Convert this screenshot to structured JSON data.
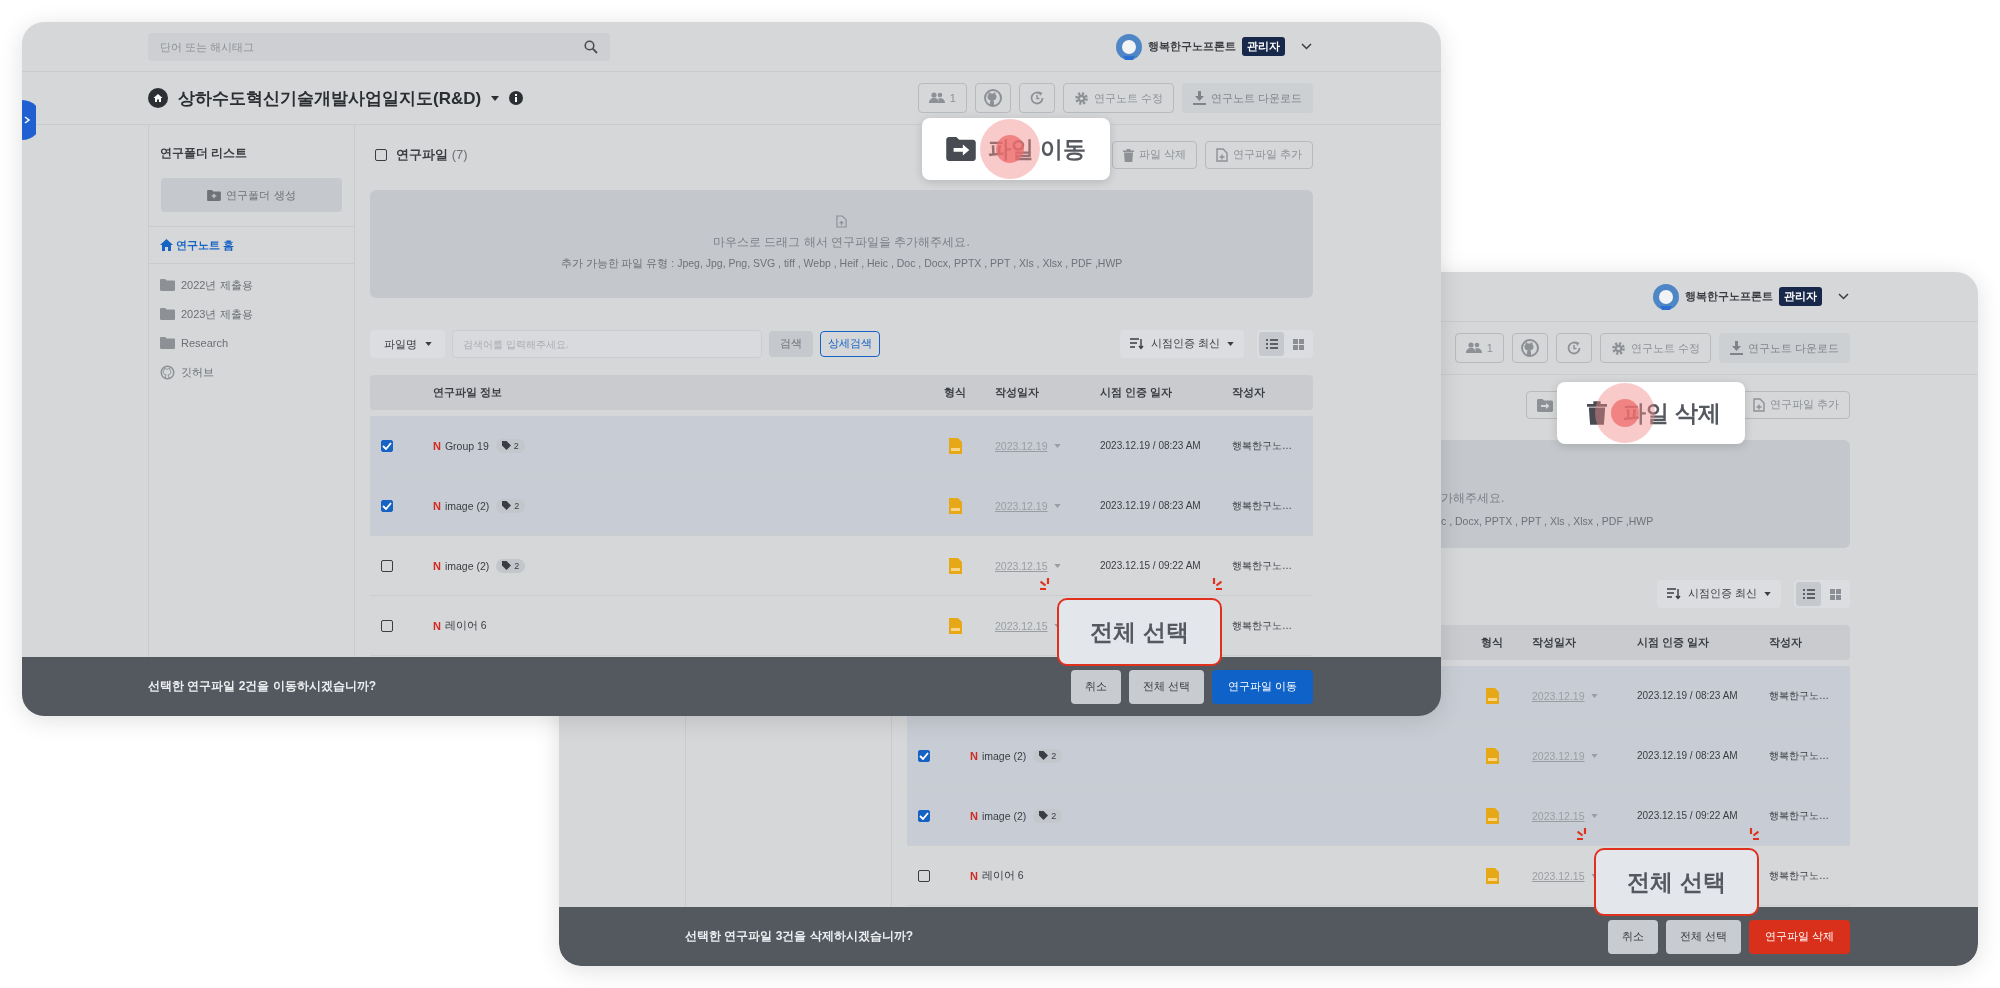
{
  "windows": [
    {
      "sidebar_toggle": true,
      "topbar": {
        "search": {
          "placeholder": "단어 또는 해시태그"
        },
        "user": {
          "name": "행복한구노프론트",
          "badge": "관리자"
        }
      },
      "header": {
        "title": "상하수도혁신기술개발사업일지도(R&D)",
        "toolbar": [
          {
            "kind": "members",
            "label": "1",
            "disabled": false
          },
          {
            "kind": "github",
            "disabled": false
          },
          {
            "kind": "history",
            "disabled": false
          },
          {
            "kind": "settings",
            "label": "연구노트 수정",
            "disabled": false
          },
          {
            "kind": "download",
            "label": "연구노트 다운로드",
            "disabled": true
          }
        ]
      },
      "folders": {
        "title": "연구폴더 리스트",
        "create_button": "연구폴더 생성",
        "home": "연구노트 홈",
        "items": [
          {
            "kind": "folder",
            "label": "2022년 제출용"
          },
          {
            "kind": "folder",
            "label": "2023년 제출용"
          },
          {
            "kind": "folder",
            "label": "Research"
          },
          {
            "kind": "github",
            "label": "깃허브"
          }
        ]
      },
      "files": {
        "title": "연구파일",
        "count": "(7)",
        "checked": false,
        "actions": [
          {
            "kind": "delete",
            "label": "파일 삭제"
          },
          {
            "kind": "add",
            "label": "연구파일 추가"
          }
        ],
        "dropzone": {
          "kind": "full",
          "message": "마우스로 드래그 해서 연구파일을 추가해주세요.",
          "types": "추가 가능한 파일 유형 : Jpeg, Jpg, Png, SVG , tiff , Webp , Heif , Heic , Doc , Docx, PPTX , PPT , Xls , Xlsx , PDF ,HWP"
        },
        "filter": {
          "field": "파일명",
          "placeholder": "검색어를 입력해주세요.",
          "search_button": "검색",
          "advanced_button": "상세검색",
          "sort": "시점인증 최신",
          "views": [
            {
              "kind": "list",
              "selected": true
            },
            {
              "kind": "grid",
              "selected": false
            }
          ]
        },
        "columns": [
          {
            "kind": "info",
            "label": "연구파일 정보"
          },
          {
            "kind": "format",
            "label": "형식"
          },
          {
            "kind": "date",
            "label": "작성일자"
          },
          {
            "kind": "certified",
            "label": "시점 인증 일자"
          },
          {
            "kind": "author",
            "label": "작성자"
          }
        ],
        "rows": [
          {
            "checked": true,
            "badge": "N",
            "name": "Group 19",
            "tags": "2",
            "date": "2023.12.19",
            "certified": "2023.12.19 / 08:23 AM",
            "author": "행복한구노…"
          },
          {
            "checked": true,
            "badge": "N",
            "name": "image (2)",
            "tags": "2",
            "date": "2023.12.19",
            "certified": "2023.12.19 / 08:23 AM",
            "author": "행복한구노…"
          },
          {
            "checked": false,
            "badge": "N",
            "name": "image (2)",
            "tags": "2",
            "date": "2023.12.15",
            "certified": "2023.12.15 / 09:22 AM",
            "author": "행복한구노…"
          },
          {
            "checked": false,
            "badge": "N",
            "name": "레이어 6",
            "date": "2023.12.15",
            "author": "행복한구노…"
          }
        ]
      },
      "confirm_bar": {
        "message": "선택한 연구파일 2건을 이동하시겠습니까?",
        "buttons": [
          {
            "kind": "cancel",
            "label": "취소"
          },
          {
            "kind": "select_all",
            "label": "전체 선택"
          },
          {
            "kind": "move",
            "label": "연구파일 이동"
          }
        ]
      },
      "callouts": [
        {
          "kind": "move",
          "label": "파일 이동"
        },
        {
          "kind": "select_all",
          "label": "전체 선택"
        }
      ]
    },
    {
      "sidebar_toggle": false,
      "topbar": {
        "user": {
          "name": "행복한구노프론트",
          "badge": "관리자"
        }
      },
      "header": {
        "toolbar": [
          {
            "kind": "members",
            "label": "1",
            "disabled": false
          },
          {
            "kind": "github",
            "disabled": false
          },
          {
            "kind": "history",
            "disabled": false
          },
          {
            "kind": "settings",
            "label": "연구노트 수정",
            "disabled": false
          },
          {
            "kind": "download",
            "label": "연구노트 다운로드",
            "disabled": true
          }
        ]
      },
      "files": {
        "actions": [
          {
            "kind": "move"
          },
          {
            "kind": "add",
            "label": "연구파일 추가"
          }
        ],
        "dropzone": {
          "kind": "partial",
          "message": "가해주세요.",
          "types": "c , Docx, PPTX , PPT , Xls , Xlsx , PDF ,HWP"
        },
        "filter": {
          "sort": "시점인증 최신",
          "views": [
            {
              "kind": "list",
              "selected": true
            },
            {
              "kind": "grid",
              "selected": false
            }
          ]
        },
        "columns": [
          {
            "kind": "format",
            "label": "형식"
          },
          {
            "kind": "date",
            "label": "작성일자"
          },
          {
            "kind": "certified",
            "label": "시점 인증 일자"
          },
          {
            "kind": "author",
            "label": "작성자"
          }
        ],
        "rows": [
          {
            "checked": true,
            "date": "2023.12.19",
            "certified": "2023.12.19 / 08:23 AM",
            "author": "행복한구노…"
          },
          {
            "checked": true,
            "badge": "N",
            "name": "image (2)",
            "tags": "2",
            "date": "2023.12.19",
            "certified": "2023.12.19 / 08:23 AM",
            "author": "행복한구노…"
          },
          {
            "checked": true,
            "badge": "N",
            "name": "image (2)",
            "tags": "2",
            "date": "2023.12.15",
            "certified": "2023.12.15 / 09:22 AM",
            "author": "행복한구노…"
          },
          {
            "checked": false,
            "badge": "N",
            "name": "레이어 6",
            "date": "2023.12.15",
            "author": "행복한구노…"
          }
        ]
      },
      "confirm_bar": {
        "message": "선택한 연구파일 3건을 삭제하시겠습니까?",
        "buttons": [
          {
            "kind": "cancel",
            "label": "취소"
          },
          {
            "kind": "select_all",
            "label": "전체 선택"
          },
          {
            "kind": "delete",
            "label": "연구파일 삭제"
          }
        ]
      },
      "callouts": [
        {
          "kind": "delete",
          "label": "파일 삭제"
        },
        {
          "kind": "select_all",
          "label": "전체 선택"
        }
      ]
    }
  ]
}
